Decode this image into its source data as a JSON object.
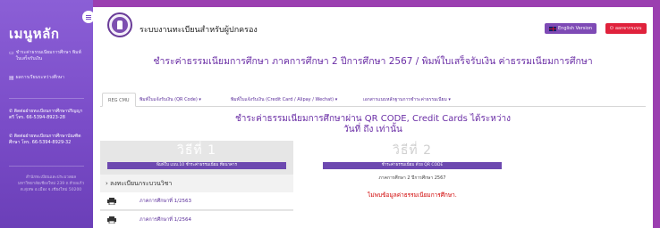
{
  "sidebar": {
    "title": "เมนูหลัก",
    "links": [
      {
        "icon": "monitor-icon",
        "text": "ชำระค่าธรรมเนียมการศึกษา พิมพ์ใบเสร็จรับเงิน"
      },
      {
        "icon": "file-icon",
        "text": "ผลการเรียนระหว่างศึกษา"
      }
    ],
    "contacts": [
      "ติดต่อฝ่ายทะเบียนการศึกษาปริญญาตรี โทร. 66-5394-8923-28",
      "ติดต่อฝ่ายทะเบียนการศึกษาบัณฑิตศึกษา โทร. 66-5394-8929-32"
    ],
    "address": "สำนักทะเบียนและประมวลผล มหาวิทยาลัยเชียงใหม่ 239 ถ.ห้วยแก้ว ต.สุเทพ อ.เมือง จ.เชียงใหม่ 50200"
  },
  "header": {
    "site_title": "ระบบงานทะเบียนสำหรับผู้ปกครอง",
    "english_button": "English Version",
    "logout_button": "ออกจากระบบ"
  },
  "page_heading": "ชำระค่าธรรมเนียมการศึกษา ภาคการศึกษา 2 ปีการศึกษา 2567 / พิมพ์ใบเสร็จรับเงิน ค่าธรรมเนียมการศึกษา",
  "nav": {
    "items": [
      "REG CMU",
      "พิมพ์ใบแจ้งรับเงิน (QR Code) ▾",
      "พิมพ์ใบแจ้งรับเงิน (Credit Card / Alipay / Wechat) ▾",
      "เอกสารแนบหลักฐานการชำระค่าธรรมเนียม ▾"
    ]
  },
  "main": {
    "heading_line1": "ชำระค่าธรรมเนียมการศึกษาผ่าน QR CODE, Credit Cards ได้ระหว่าง",
    "heading_line2": "วันที่ ถึง เท่านั้น"
  },
  "method1": {
    "title": "วิธีที่ 1",
    "bar_text": "พิมพ์ใบ แบบ.10 ชำระค่าธรรมเนียม ที่ธนาคาร",
    "list_header": "› ลงทะเบียนกระบวนวิชา",
    "rows": [
      "ภาคการศึกษาที่ 1/2563",
      "ภาคการศึกษาที่ 1/2564"
    ]
  },
  "method2": {
    "title": "วิธีที่ 2",
    "bar_text": "ชำระค่าธรรมเนียม ด้วย QR CODE",
    "term_text": "ภาคการศึกษา 2 ปีการศึกษา 2567",
    "no_data_text": "ไม่พบข้อมูลค่าธรรมเนียมการศึกษา."
  },
  "colors": {
    "sidebar": "#7a4cc8",
    "accent_purple": "#6b2fa6",
    "logout_red": "#e0223c",
    "error_red": "#d00000"
  }
}
